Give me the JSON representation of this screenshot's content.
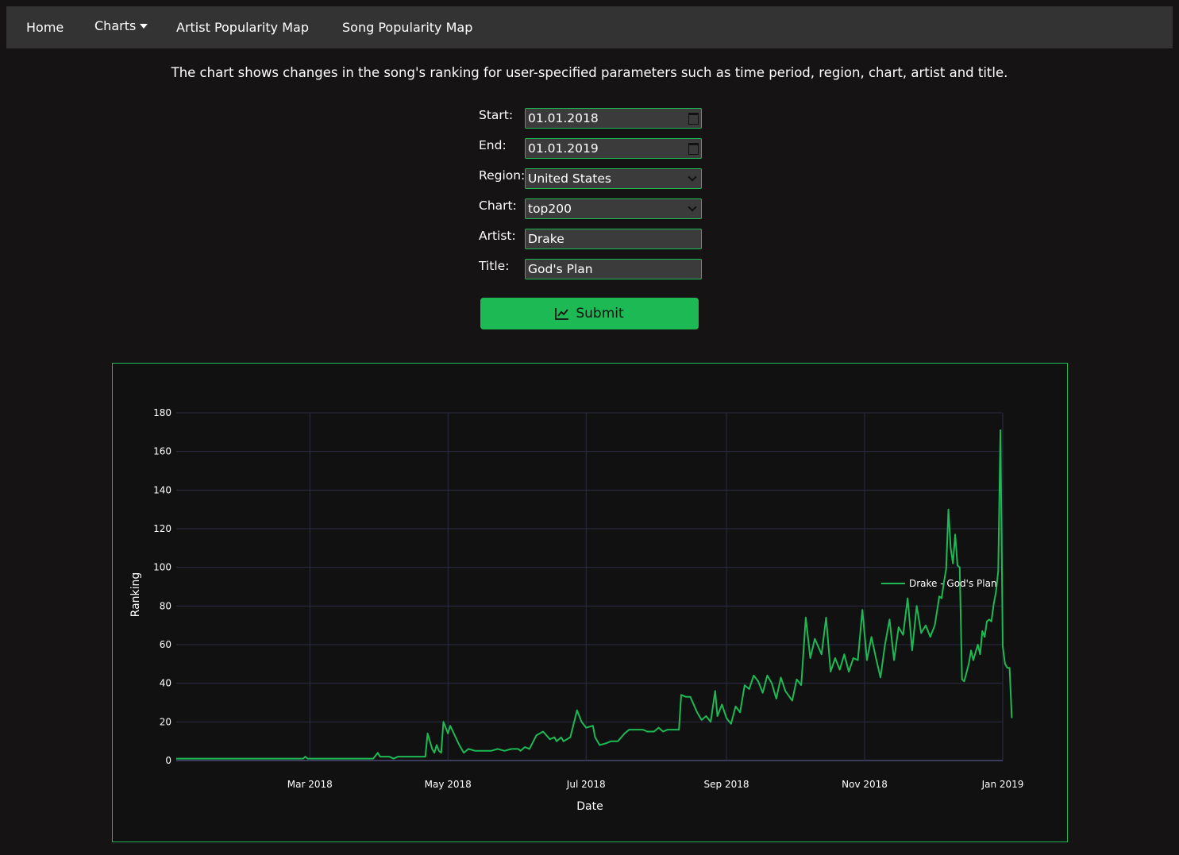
{
  "nav": {
    "home": "Home",
    "charts": "Charts",
    "artist_map": "Artist Popularity Map",
    "song_map": "Song Popularity Map"
  },
  "description": "The chart shows changes in the song's ranking for user-specified parameters such as time period, region, chart, artist and title.",
  "form": {
    "start_label": "Start:",
    "start_value": "01.01.2018",
    "end_label": "End:",
    "end_value": "01.01.2019",
    "region_label": "Region:",
    "region_value": "United States",
    "chart_label": "Chart:",
    "chart_value": "top200",
    "artist_label": "Artist:",
    "artist_value": "Drake",
    "title_label": "Title:",
    "title_value": "God's Plan",
    "submit_label": "Submit"
  },
  "colors": {
    "accent": "#1db954",
    "nav_bg": "#333333",
    "page_bg": "#151313",
    "plot_bg": "#111111",
    "grid": "#2b2d44"
  },
  "icons": {
    "submit": "chart-line-icon",
    "date": "calendar-icon",
    "select": "chevron-down-icon",
    "nav_charts": "caret-down-icon"
  },
  "chart_data": {
    "type": "line",
    "xlabel": "Date",
    "ylabel": "Ranking",
    "ylim": [
      0,
      180
    ],
    "xlim": [
      "2018-01-01",
      "2019-01-01"
    ],
    "x_ticks": [
      "Mar 2018",
      "May 2018",
      "Jul 2018",
      "Sep 2018",
      "Nov 2018",
      "Jan 2019"
    ],
    "y_ticks": [
      0,
      20,
      40,
      60,
      80,
      100,
      120,
      140,
      160,
      180
    ],
    "grid": true,
    "legend_position": "right",
    "series": [
      {
        "name": "Drake - God's Plan",
        "color": "#1db954",
        "points": [
          [
            "2018-01-01",
            1
          ],
          [
            "2018-02-10",
            1
          ],
          [
            "2018-02-26",
            1
          ],
          [
            "2018-02-27",
            2
          ],
          [
            "2018-02-28",
            1
          ],
          [
            "2018-03-29",
            1
          ],
          [
            "2018-03-31",
            4
          ],
          [
            "2018-04-01",
            2
          ],
          [
            "2018-04-05",
            2
          ],
          [
            "2018-04-07",
            1
          ],
          [
            "2018-04-09",
            2
          ],
          [
            "2018-04-21",
            2
          ],
          [
            "2018-04-22",
            14
          ],
          [
            "2018-04-24",
            6
          ],
          [
            "2018-04-25",
            4
          ],
          [
            "2018-04-26",
            8
          ],
          [
            "2018-04-27",
            5
          ],
          [
            "2018-04-28",
            4
          ],
          [
            "2018-04-29",
            20
          ],
          [
            "2018-04-30",
            17
          ],
          [
            "2018-05-01",
            14
          ],
          [
            "2018-05-02",
            18
          ],
          [
            "2018-05-04",
            13
          ],
          [
            "2018-05-06",
            8
          ],
          [
            "2018-05-08",
            4
          ],
          [
            "2018-05-10",
            6
          ],
          [
            "2018-05-13",
            5
          ],
          [
            "2018-05-20",
            5
          ],
          [
            "2018-05-23",
            6
          ],
          [
            "2018-05-26",
            5
          ],
          [
            "2018-05-29",
            6
          ],
          [
            "2018-06-01",
            6
          ],
          [
            "2018-06-02",
            5
          ],
          [
            "2018-06-04",
            7
          ],
          [
            "2018-06-06",
            6
          ],
          [
            "2018-06-09",
            13
          ],
          [
            "2018-06-12",
            15
          ],
          [
            "2018-06-15",
            11
          ],
          [
            "2018-06-17",
            12
          ],
          [
            "2018-06-18",
            10
          ],
          [
            "2018-06-20",
            12
          ],
          [
            "2018-06-21",
            10
          ],
          [
            "2018-06-24",
            12
          ],
          [
            "2018-06-27",
            26
          ],
          [
            "2018-06-29",
            20
          ],
          [
            "2018-07-01",
            17
          ],
          [
            "2018-07-04",
            18
          ],
          [
            "2018-07-05",
            12
          ],
          [
            "2018-07-07",
            8
          ],
          [
            "2018-07-10",
            9
          ],
          [
            "2018-07-12",
            10
          ],
          [
            "2018-07-15",
            10
          ],
          [
            "2018-07-18",
            14
          ],
          [
            "2018-07-20",
            16
          ],
          [
            "2018-07-26",
            16
          ],
          [
            "2018-07-28",
            15
          ],
          [
            "2018-07-31",
            15
          ],
          [
            "2018-08-02",
            17
          ],
          [
            "2018-08-04",
            15
          ],
          [
            "2018-08-06",
            16
          ],
          [
            "2018-08-11",
            16
          ],
          [
            "2018-08-12",
            34
          ],
          [
            "2018-08-14",
            33
          ],
          [
            "2018-08-16",
            33
          ],
          [
            "2018-08-19",
            25
          ],
          [
            "2018-08-21",
            21
          ],
          [
            "2018-08-23",
            23
          ],
          [
            "2018-08-25",
            20
          ],
          [
            "2018-08-27",
            36
          ],
          [
            "2018-08-28",
            23
          ],
          [
            "2018-08-30",
            29
          ],
          [
            "2018-09-01",
            22
          ],
          [
            "2018-09-03",
            19
          ],
          [
            "2018-09-05",
            28
          ],
          [
            "2018-09-07",
            25
          ],
          [
            "2018-09-09",
            39
          ],
          [
            "2018-09-11",
            37
          ],
          [
            "2018-09-13",
            44
          ],
          [
            "2018-09-15",
            41
          ],
          [
            "2018-09-17",
            35
          ],
          [
            "2018-09-19",
            44
          ],
          [
            "2018-09-21",
            40
          ],
          [
            "2018-09-23",
            32
          ],
          [
            "2018-09-25",
            43
          ],
          [
            "2018-09-27",
            36
          ],
          [
            "2018-09-30",
            31
          ],
          [
            "2018-10-02",
            42
          ],
          [
            "2018-10-04",
            39
          ],
          [
            "2018-10-06",
            74
          ],
          [
            "2018-10-08",
            53
          ],
          [
            "2018-10-10",
            63
          ],
          [
            "2018-10-13",
            55
          ],
          [
            "2018-10-15",
            74
          ],
          [
            "2018-10-17",
            46
          ],
          [
            "2018-10-19",
            53
          ],
          [
            "2018-10-21",
            47
          ],
          [
            "2018-10-23",
            55
          ],
          [
            "2018-10-25",
            46
          ],
          [
            "2018-10-27",
            53
          ],
          [
            "2018-10-29",
            52
          ],
          [
            "2018-10-31",
            78
          ],
          [
            "2018-11-02",
            52
          ],
          [
            "2018-11-04",
            64
          ],
          [
            "2018-11-06",
            53
          ],
          [
            "2018-11-08",
            43
          ],
          [
            "2018-11-10",
            60
          ],
          [
            "2018-11-12",
            73
          ],
          [
            "2018-11-14",
            52
          ],
          [
            "2018-11-16",
            69
          ],
          [
            "2018-11-18",
            65
          ],
          [
            "2018-11-20",
            84
          ],
          [
            "2018-11-22",
            57
          ],
          [
            "2018-11-24",
            80
          ],
          [
            "2018-11-26",
            66
          ],
          [
            "2018-11-28",
            70
          ],
          [
            "2018-11-30",
            64
          ],
          [
            "2018-12-02",
            70
          ],
          [
            "2018-12-04",
            85
          ],
          [
            "2018-12-05",
            84
          ],
          [
            "2018-12-06",
            92
          ],
          [
            "2018-12-07",
            99
          ],
          [
            "2018-12-08",
            130
          ],
          [
            "2018-12-09",
            110
          ],
          [
            "2018-12-10",
            102
          ],
          [
            "2018-12-11",
            117
          ],
          [
            "2018-12-12",
            101
          ],
          [
            "2018-12-13",
            100
          ],
          [
            "2018-12-14",
            42
          ],
          [
            "2018-12-15",
            41
          ],
          [
            "2018-12-17",
            50
          ],
          [
            "2018-12-18",
            57
          ],
          [
            "2018-12-19",
            52
          ],
          [
            "2018-12-21",
            60
          ],
          [
            "2018-12-22",
            55
          ],
          [
            "2018-12-23",
            67
          ],
          [
            "2018-12-24",
            64
          ],
          [
            "2018-12-25",
            72
          ],
          [
            "2018-12-26",
            73
          ],
          [
            "2018-12-27",
            72
          ],
          [
            "2018-12-28",
            81
          ],
          [
            "2018-12-29",
            87
          ],
          [
            "2018-12-30",
            98
          ],
          [
            "2018-12-31",
            171
          ],
          [
            "2019-01-01",
            59
          ],
          [
            "2019-01-02",
            50
          ],
          [
            "2019-01-03",
            48
          ],
          [
            "2019-01-04",
            48
          ],
          [
            "2019-01-05",
            22
          ]
        ]
      }
    ]
  }
}
